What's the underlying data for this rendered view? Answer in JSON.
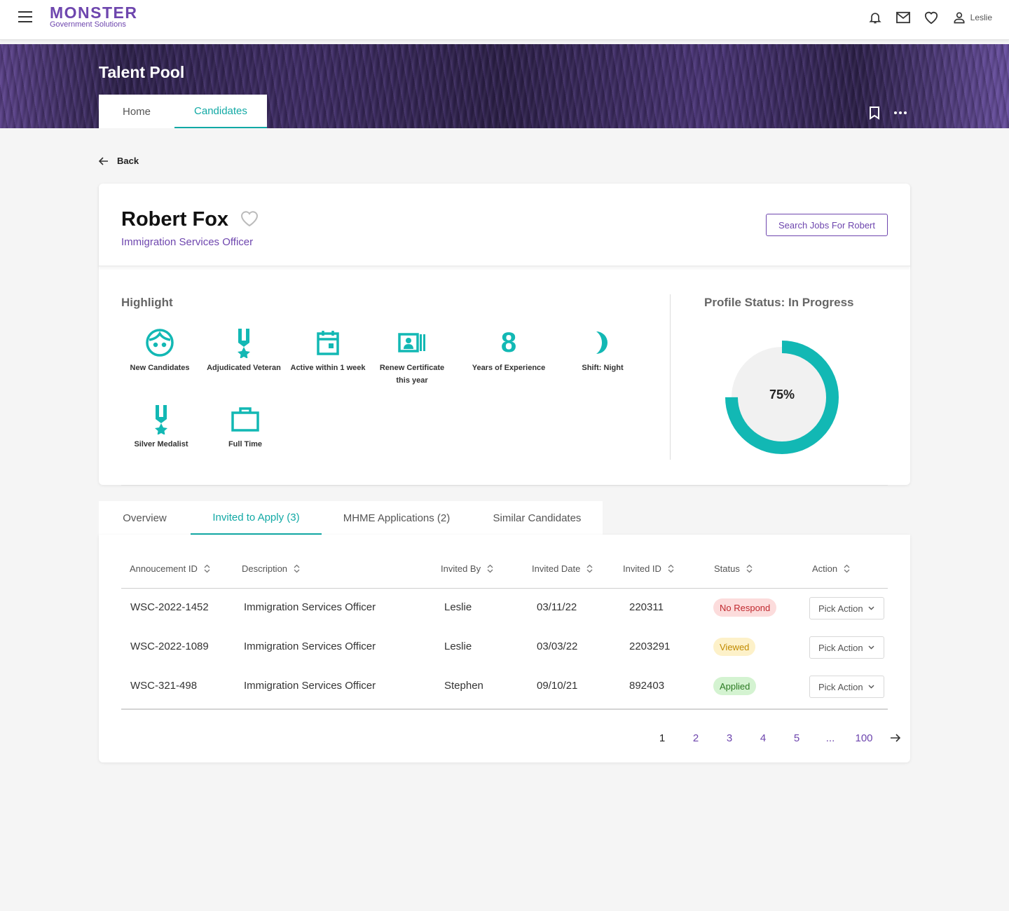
{
  "topnav": {
    "logo_main": "MONSTER",
    "logo_sub": "Government Solutions",
    "user_name": "Leslie"
  },
  "banner": {
    "title": "Talent Pool",
    "tabs": [
      {
        "label": "Home"
      },
      {
        "label": "Candidates"
      }
    ]
  },
  "back_label": "Back",
  "profile": {
    "name": "Robert Fox",
    "job_title": "Immigration Services Officer",
    "search_button": "Search Jobs For Robert"
  },
  "highlight": {
    "label": "Highlight",
    "items": [
      {
        "label": "New Candidates",
        "icon": "face-icon"
      },
      {
        "label": "Adjudicated Veteran",
        "icon": "medal-icon"
      },
      {
        "label": "Active within 1 week",
        "icon": "calendar-icon"
      },
      {
        "label": "Renew Certificate this year",
        "icon": "certificate-icon"
      },
      {
        "label": "Years of Experience",
        "icon": "number-8-icon",
        "value": "8"
      },
      {
        "label": "Shift: Night",
        "icon": "moon-icon"
      },
      {
        "label": "Silver Medalist",
        "icon": "medal-icon"
      },
      {
        "label": "Full Time",
        "icon": "briefcase-icon"
      }
    ]
  },
  "profile_status": {
    "label": "Profile Status: In Progress",
    "percent_text": "75%",
    "percent": 0.75,
    "color": "#12b8b4"
  },
  "lower_tabs": [
    {
      "label": "Overview"
    },
    {
      "label": "Invited to Apply (3)"
    },
    {
      "label": "MHME Applications (2)"
    },
    {
      "label": "Similar Candidates"
    }
  ],
  "table": {
    "headers": [
      "Annoucement ID",
      "Description",
      "Invited By",
      "Invited Date",
      "Invited ID",
      "Status",
      "Action"
    ],
    "rows": [
      {
        "id": "WSC-2022-1452",
        "description": "Immigration Services Officer",
        "invited_by": "Leslie",
        "date": "03/11/22",
        "invited_id": "220311",
        "status": "No Respond",
        "action": "Pick Action"
      },
      {
        "id": "WSC-2022-1089",
        "description": "Immigration Services Officer",
        "invited_by": "Leslie",
        "date": "03/03/22",
        "invited_id": "2203291",
        "status": "Viewed",
        "action": "Pick Action"
      },
      {
        "id": "WSC-321-498",
        "description": "Immigration Services Officer",
        "invited_by": "Stephen",
        "date": "09/10/21",
        "invited_id": "892403",
        "status": "Applied",
        "action": "Pick Action"
      }
    ]
  },
  "status_colors": {
    "No Respond": {
      "bg": "#fcdcdc",
      "fg": "#c0282e"
    },
    "Viewed": {
      "bg": "#fdf1c9",
      "fg": "#c08a00"
    },
    "Applied": {
      "bg": "#d4f3d1",
      "fg": "#2b7a22"
    }
  },
  "pagination": {
    "pages": [
      "1",
      "2",
      "3",
      "4",
      "5"
    ],
    "ellipsis": "...",
    "last": "100",
    "current": "1"
  },
  "colors": {
    "brand": "#6e46ae",
    "accent": "#12a9a5"
  }
}
